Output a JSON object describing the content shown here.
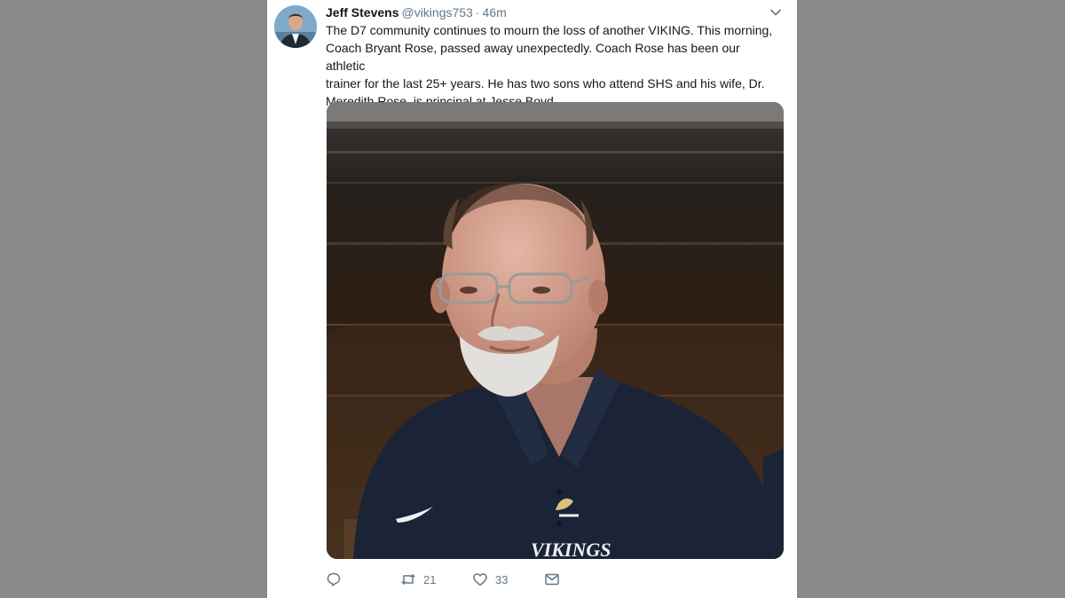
{
  "tweet": {
    "author_name": "Jeff Stevens",
    "handle": "@vikings753",
    "separator": "·",
    "time": "46m",
    "text": "The D7 community continues to mourn the loss of another VIKING. This morning,\nCoach Bryant Rose, passed away unexpectedly. Coach Rose has been our athletic\ntrainer for the last 25+ years. He has two sons who attend SHS and his wife, Dr.\nMeredith Rose, is principal at Jesse Boyd.",
    "photo_shirt_logo_text": "VIKINGS"
  },
  "actions": {
    "reply_count": "",
    "retweet_count": "21",
    "like_count": "33"
  },
  "icons": {
    "more": "chevron-down-icon",
    "reply": "reply-icon",
    "retweet": "retweet-icon",
    "like": "heart-icon",
    "message": "envelope-icon"
  },
  "colors": {
    "side_background": "#8a8a8a",
    "card_background": "#ffffff",
    "text_primary": "#14171a",
    "text_secondary": "#657786"
  }
}
